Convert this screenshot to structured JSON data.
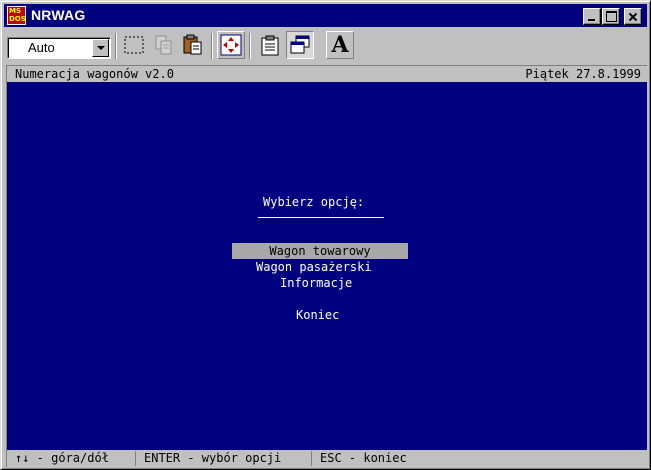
{
  "window": {
    "title": "NRWAG",
    "icon_letters": [
      "MS",
      "DOS"
    ]
  },
  "toolbar": {
    "font_size_value": "Auto",
    "tools": [
      "mark-icon",
      "copy-icon",
      "paste-icon",
      "fullscreen-icon",
      "properties-icon",
      "background-icon",
      "font-icon"
    ],
    "font_button_label": "A"
  },
  "console": {
    "header_title": "Numeracja wagonów v2.0",
    "header_date": "Piątek 27.8.1999",
    "prompt": "Wybierz opcję:",
    "menu": [
      {
        "label": "Wagon towarowy",
        "selected": true
      },
      {
        "label": "Wagon pasażerski",
        "selected": false
      },
      {
        "label": "Informacje",
        "selected": false
      },
      {
        "label": "Koniec",
        "selected": false
      }
    ],
    "status": [
      "↑↓ - góra/dół",
      "ENTER - wybór opcji",
      "ESC - koniec"
    ]
  },
  "colors": {
    "console_bg": "#000080",
    "selection_bg": "#a8a8a8",
    "chrome": "#c0c0c0"
  }
}
